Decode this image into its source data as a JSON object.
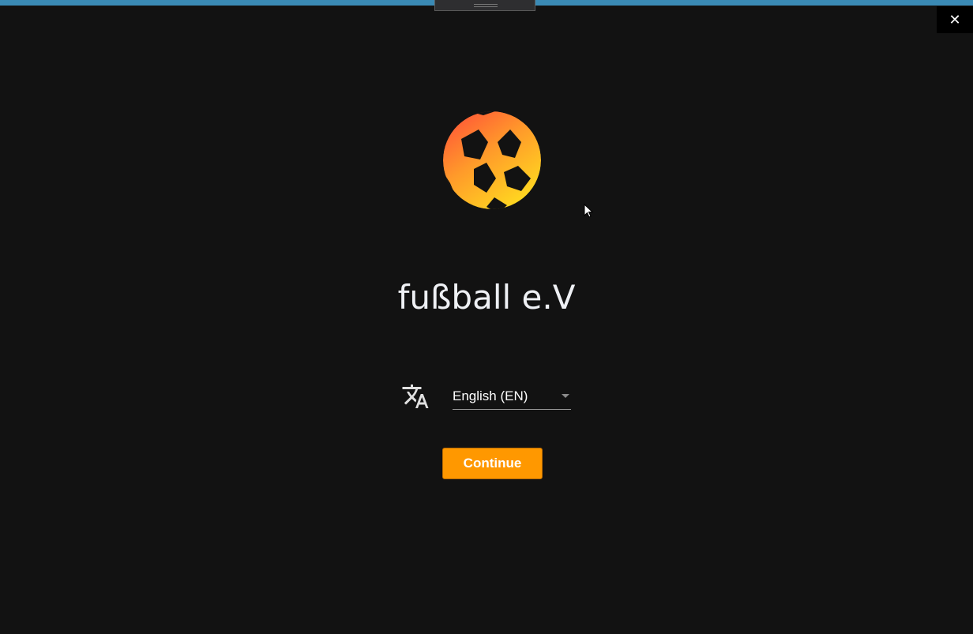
{
  "window": {
    "close_icon": "close-icon",
    "close_glyph": "✕"
  },
  "app": {
    "title": "fußball e.V"
  },
  "language": {
    "icon": "translate-icon",
    "selected": "English (EN)"
  },
  "continue_label": "Continue",
  "colors": {
    "accent": "#ff9800",
    "topbar": "#3a8ab5",
    "background": "#121212"
  }
}
